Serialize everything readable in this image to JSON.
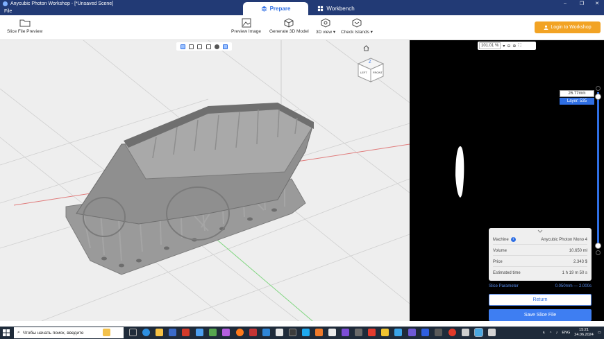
{
  "window": {
    "title": "Anycubic Photon Workshop - [*Unsaved Scene]",
    "menu": [
      "File"
    ],
    "controls": [
      "–",
      "❐",
      "✕"
    ]
  },
  "tabs": [
    {
      "label": "Prepare",
      "active": true,
      "icon": "layers-icon"
    },
    {
      "label": "Workbench",
      "active": false,
      "icon": "grid-icon"
    }
  ],
  "toolbar": {
    "slice_file_preview": "Slice File Preview",
    "preview_image": "Preview Image",
    "generate_3d_model": "Generate 3D Model",
    "view_3d": "3D view",
    "check_islands": "Check Islands",
    "login": "Login to Workshop"
  },
  "viewcube": {
    "top": "Z",
    "left": "LEFT",
    "front": "FRONT"
  },
  "slice_preview": {
    "zoom": "101.01 %",
    "height": "26.77mm",
    "layer": "Layer: 535"
  },
  "info": {
    "machine_label": "Machine",
    "machine_value": "Anycubic Photon Mono 4",
    "volume_label": "Volume",
    "volume_value": "10.650 ml",
    "price_label": "Price",
    "price_value": "2.343 $",
    "time_label": "Estimated time",
    "time_value": "1 h 19 m 50 s"
  },
  "slice_param": {
    "label": "Slice Parameter",
    "value": "0.050mm — 2.000s"
  },
  "buttons": {
    "return": "Return",
    "save": "Save Slice File"
  },
  "taskbar": {
    "search_placeholder": "Чтобы начать поиск, введите",
    "language": "ENG",
    "time": "15:21",
    "date": "24.06.2024"
  },
  "colors": {
    "accent": "#2f6fe4",
    "login": "#f2a324",
    "titlebar": "#223a75",
    "model": "#8a8a8a"
  }
}
